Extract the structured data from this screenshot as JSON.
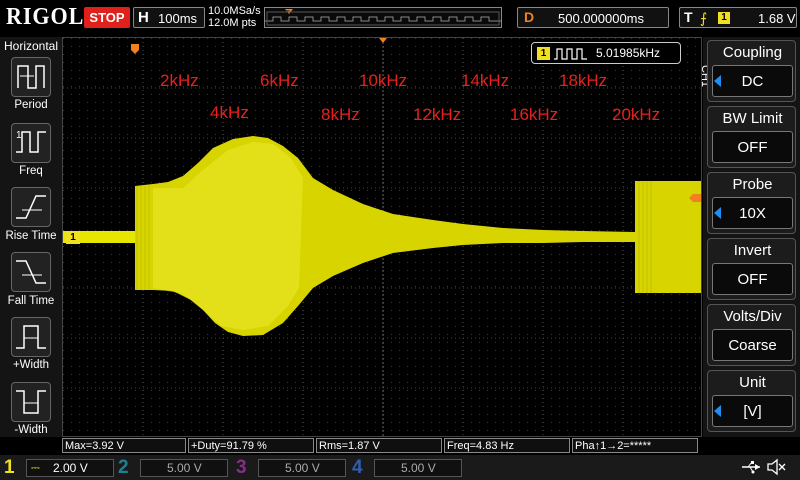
{
  "brand": "RIGOL",
  "run_state": "STOP",
  "horizontal": {
    "key": "H",
    "timebase": "100ms",
    "sample_rate": "10.0MSa/s",
    "mem_depth": "12.0M pts"
  },
  "delay": {
    "key": "D",
    "value": "500.000000ms"
  },
  "trigger": {
    "key": "T",
    "source": "1",
    "level": "1.68 V"
  },
  "left_menu": {
    "title": "Horizontal",
    "items": [
      {
        "label": "Period"
      },
      {
        "label": "Freq"
      },
      {
        "label": "Rise Time"
      },
      {
        "label": "Fall Time"
      },
      {
        "label": "+Width"
      },
      {
        "label": "-Width"
      }
    ]
  },
  "screen": {
    "freq_counter": "5.01985kHz",
    "freq_counter_channel": "1",
    "freq_labels_row1": [
      "2kHz",
      "6kHz",
      "10kHz",
      "14kHz",
      "18kHz"
    ],
    "freq_labels_row2": [
      "4kHz",
      "8kHz",
      "12kHz",
      "16kHz",
      "20kHz"
    ],
    "ch1_marker": "1",
    "trace_color": "#e6e600",
    "label_color": "#e8201c"
  },
  "right_menu": {
    "channel": "CH1",
    "items": [
      {
        "title": "Coupling",
        "value": "DC"
      },
      {
        "title": "BW Limit",
        "value": "OFF"
      },
      {
        "title": "Probe",
        "value": "10X"
      },
      {
        "title": "Invert",
        "value": "OFF"
      },
      {
        "title": "Volts/Div",
        "value": "Coarse"
      },
      {
        "title": "Unit",
        "value": "[V]"
      }
    ]
  },
  "measurements": [
    "Max=3.92 V",
    "+Duty=91.79 %",
    "Rms=1.87 V",
    "Freq=4.83 Hz",
    "Pha↑1→2=*****"
  ],
  "channels": [
    {
      "num": "1",
      "scale": "2.00 V",
      "color": "#f0e020"
    },
    {
      "num": "2",
      "scale": "5.00 V",
      "color": "#1fc6e8"
    },
    {
      "num": "3",
      "scale": "5.00 V",
      "color": "#d03cd0"
    },
    {
      "num": "4",
      "scale": "5.00 V",
      "color": "#3c7cf0"
    }
  ]
}
